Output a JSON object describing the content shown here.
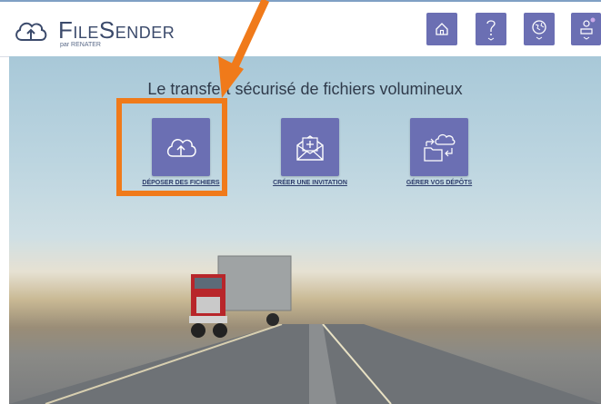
{
  "header": {
    "logo_text": "FileSender",
    "logo_sub": "par RENATER",
    "buttons": [
      {
        "name": "home",
        "icon": "home-icon"
      },
      {
        "name": "help",
        "icon": "question-icon"
      },
      {
        "name": "language",
        "icon": "globe-icon"
      },
      {
        "name": "user",
        "icon": "user-icon"
      }
    ]
  },
  "main": {
    "tagline": "Le transfert sécurisé de fichiers volumineux",
    "tiles": [
      {
        "label": "DÉPOSER DES FICHIERS",
        "icon": "cloud-upload-icon"
      },
      {
        "label": "CRÉER UNE INVITATION",
        "icon": "envelope-plus-icon"
      },
      {
        "label": "GÉRER VOS DÉPÔTS",
        "icon": "folder-cloud-icon"
      }
    ]
  },
  "colors": {
    "accent": "#6b6fb3",
    "highlight": "#f07a1a",
    "label": "#2e3d6b"
  }
}
